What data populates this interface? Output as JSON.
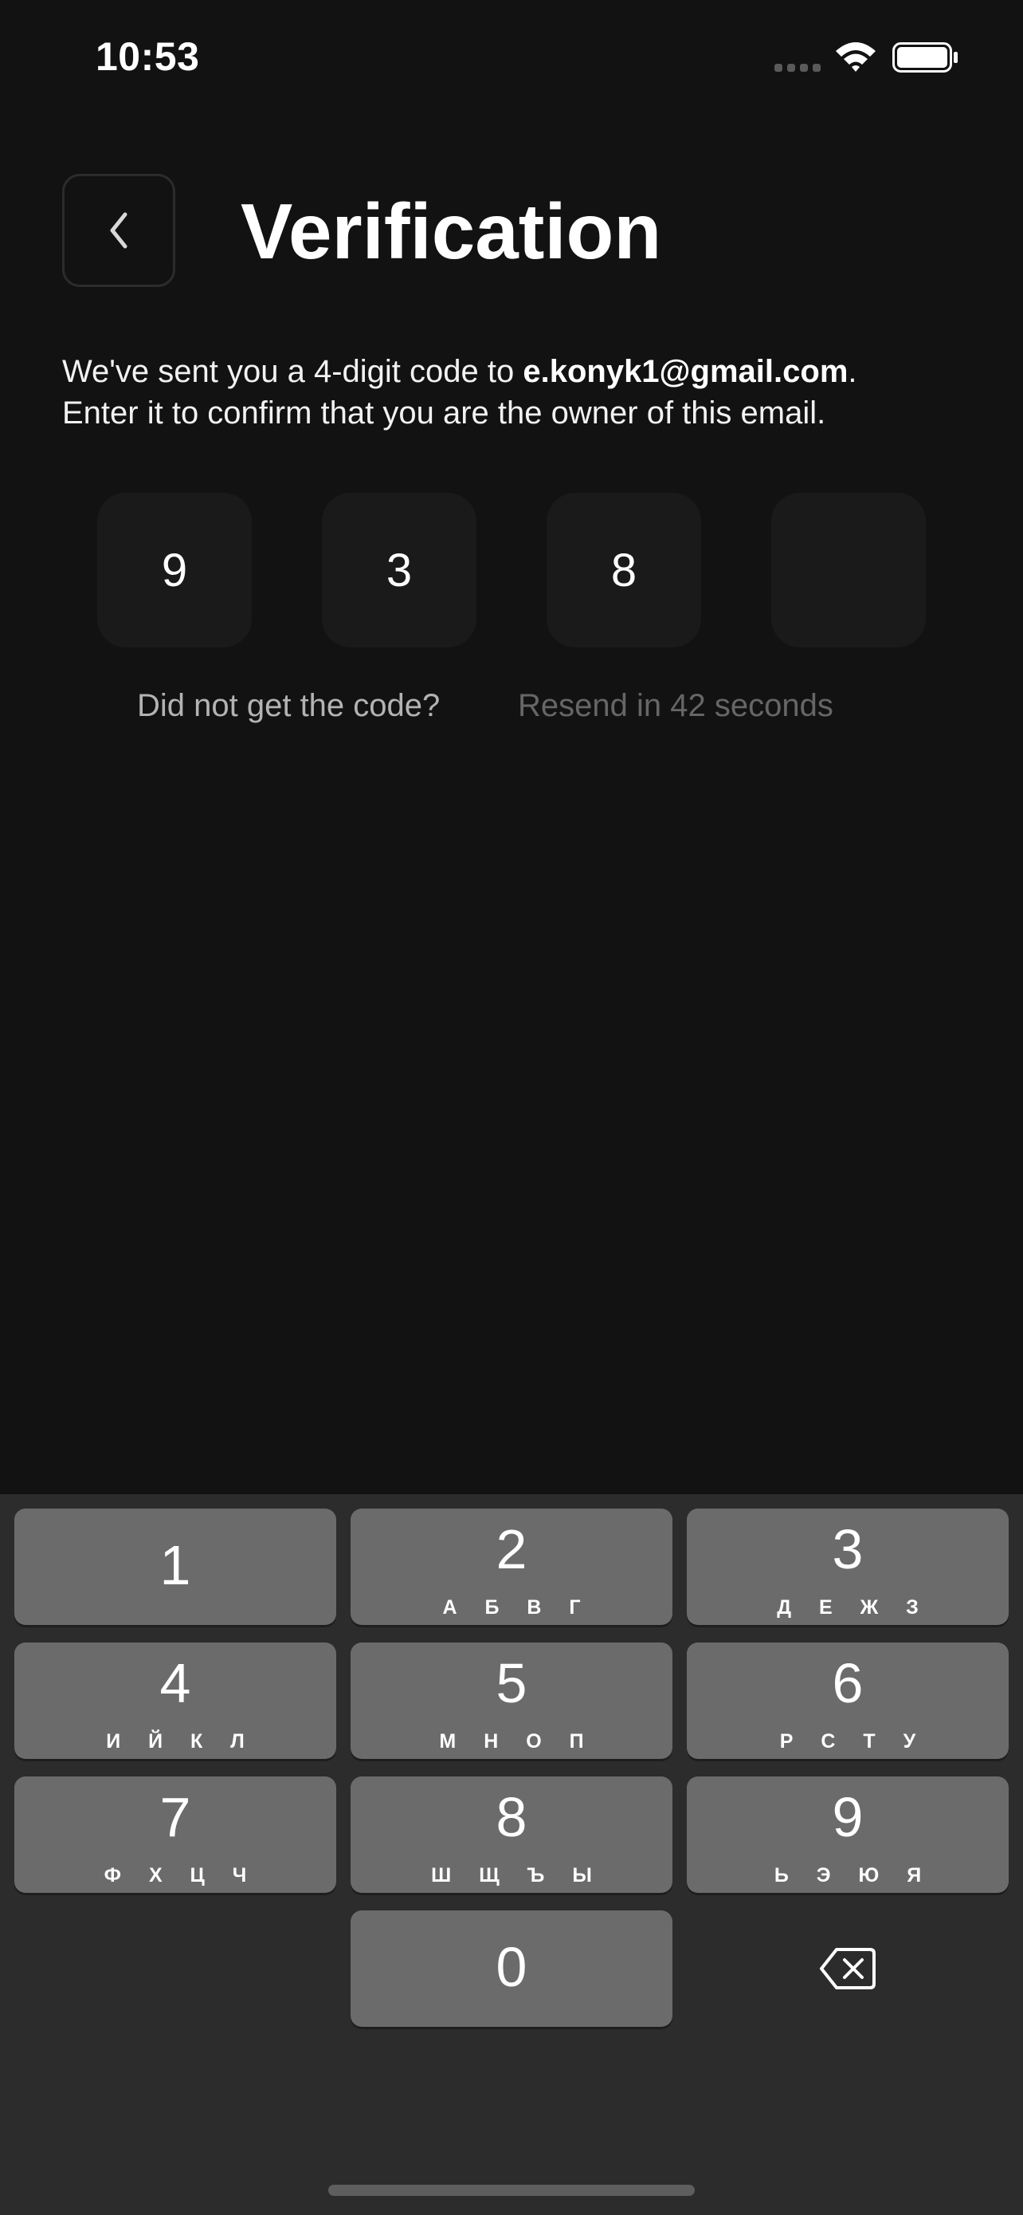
{
  "status_bar": {
    "time": "10:53",
    "icons": [
      "cellular-signal-icon",
      "wifi-icon",
      "battery-icon"
    ]
  },
  "header": {
    "back_icon": "chevron-left-icon",
    "title": "Verification"
  },
  "description": {
    "prefix": "We've sent you a 4-digit code to ",
    "email": "e.konyk1@gmail.com",
    "suffix": ".",
    "line2": "Enter it to confirm that you are the owner of this email."
  },
  "code": {
    "digits": [
      "9",
      "3",
      "8",
      ""
    ]
  },
  "resend": {
    "question": "Did not get the code?",
    "timer": "Resend in 42 seconds"
  },
  "keypad": {
    "keys": [
      {
        "digit": "1",
        "letters": ""
      },
      {
        "digit": "2",
        "letters": "А Б В Г"
      },
      {
        "digit": "3",
        "letters": "Д Е Ж З"
      },
      {
        "digit": "4",
        "letters": "И Й К Л"
      },
      {
        "digit": "5",
        "letters": "М Н О П"
      },
      {
        "digit": "6",
        "letters": "Р С Т У"
      },
      {
        "digit": "7",
        "letters": "Ф Х Ц Ч"
      },
      {
        "digit": "8",
        "letters": "Ш Щ Ъ Ы"
      },
      {
        "digit": "9",
        "letters": "Ь Э Ю Я"
      },
      {
        "digit": "0",
        "letters": ""
      }
    ],
    "delete_icon": "backspace-icon"
  },
  "colors": {
    "background": "#121212",
    "code_box": "#1a1a1a",
    "keypad_background": "#2c2c2c",
    "key": "#6b6b6b",
    "secondary_text": "#b3b3b3",
    "muted_text": "#666666"
  }
}
